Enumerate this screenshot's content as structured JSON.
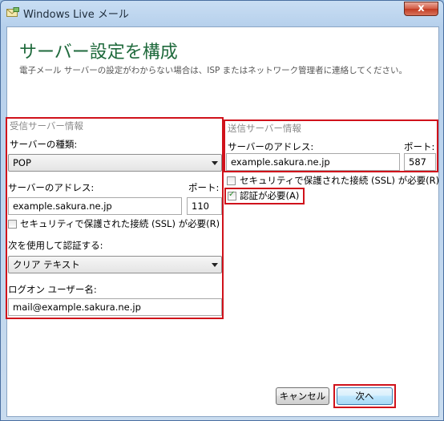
{
  "window": {
    "title": "Windows Live メール",
    "close_glyph": "x"
  },
  "page": {
    "heading": "サーバー設定を構成",
    "description": "電子メール サーバーの設定がわからない場合は、ISP またはネットワーク管理者に連絡してください。"
  },
  "incoming": {
    "group_label": "受信サーバー情報",
    "server_type_label": "サーバーの種類:",
    "server_type_value": "POP",
    "address_label": "サーバーのアドレス:",
    "address_value": "example.sakura.ne.jp",
    "port_label": "ポート:",
    "port_value": "110",
    "ssl_label": "セキュリティで保護された接続 (SSL) が必要(R)",
    "ssl_checked": false,
    "auth_method_label": "次を使用して認証する:",
    "auth_method_value": "クリア テキスト",
    "logon_label": "ログオン ユーザー名:",
    "logon_value": "mail@example.sakura.ne.jp"
  },
  "outgoing": {
    "group_label": "送信サーバー情報",
    "address_label": "サーバーのアドレス:",
    "address_value": "example.sakura.ne.jp",
    "port_label": "ポート:",
    "port_value": "587",
    "ssl_label": "セキュリティで保護された接続 (SSL) が必要(R)",
    "ssl_checked": false,
    "auth_label": "認証が必要(A)",
    "auth_checked": true
  },
  "buttons": {
    "cancel": "キャンセル",
    "next": "次へ"
  },
  "colors": {
    "heading": "#1f6a3c",
    "highlight_border": "#d0121b"
  }
}
